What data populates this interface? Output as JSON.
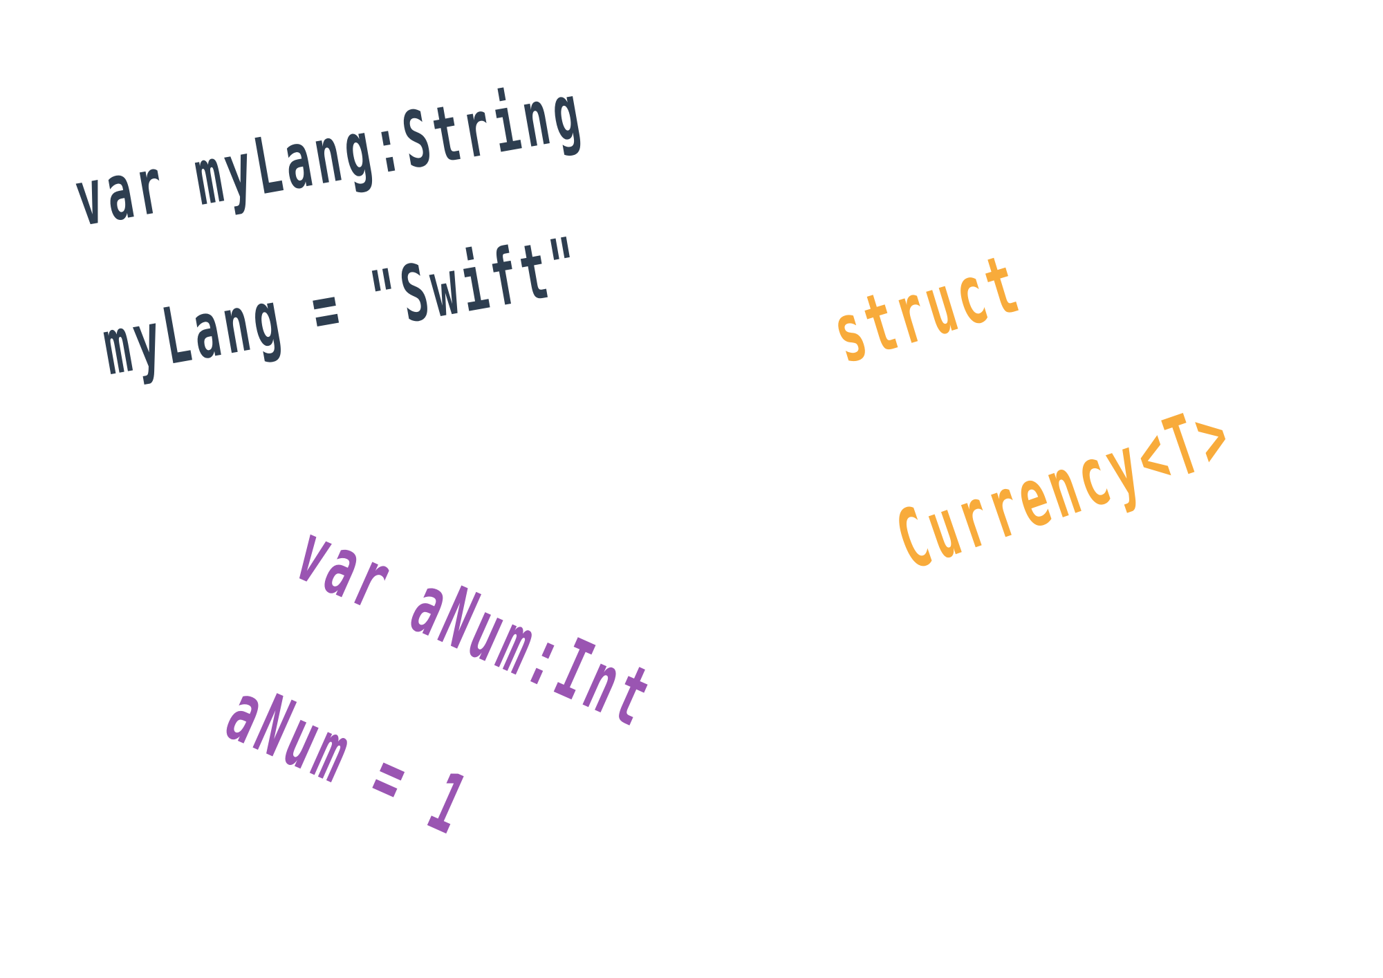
{
  "snippets": [
    {
      "color": "#2e3e50",
      "lines": [
        "var myLang:String",
        "myLang = \"Swift\""
      ]
    },
    {
      "color": "#f8ab3b",
      "lines": [
        "struct",
        "Currency<T>"
      ]
    },
    {
      "color": "#9a55b2",
      "lines": [
        "var aNum:Int",
        "aNum = 1"
      ]
    }
  ]
}
